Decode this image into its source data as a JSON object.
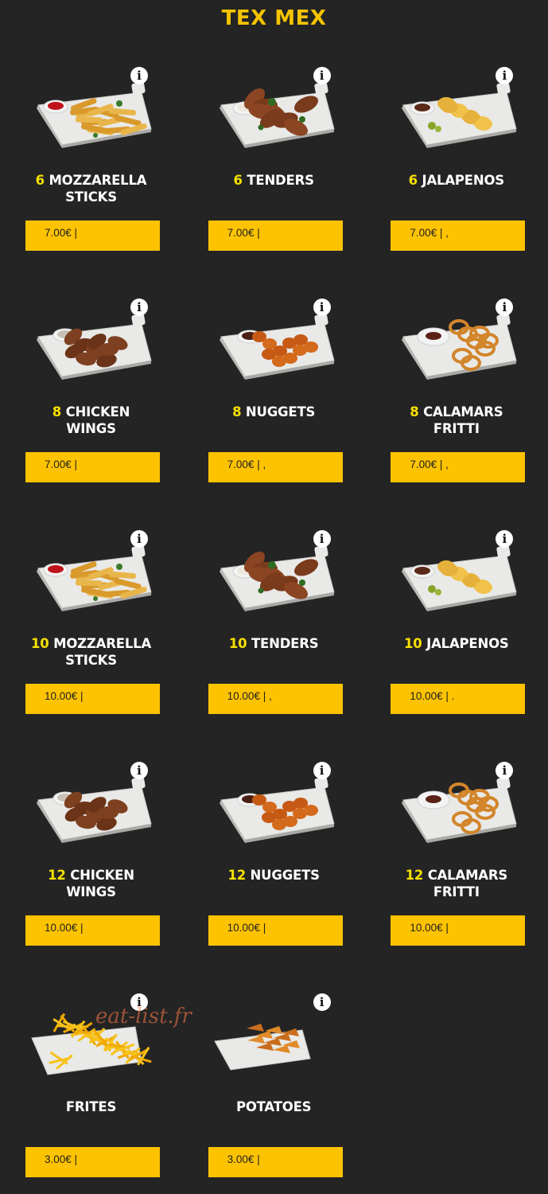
{
  "section_title": "TEX MEX",
  "watermark": "eat-list.fr",
  "items": [
    {
      "qty": "6",
      "name": "MOZZARELLA STICKS",
      "line1": "MOZZARELLA",
      "line2": "STICKS",
      "price": "7.00€ |",
      "icon": "mozzarella-sticks"
    },
    {
      "qty": "6",
      "name": "TENDERS",
      "line1": "TENDERS",
      "line2": "",
      "price": "7.00€ |",
      "icon": "tenders"
    },
    {
      "qty": "6",
      "name": "JALAPENOS",
      "line1": "JALAPENOS",
      "line2": "",
      "price": "7.00€ | ,",
      "icon": "jalapenos"
    },
    {
      "qty": "8",
      "name": "CHICKEN WINGS",
      "line1": "CHICKEN",
      "line2": "WINGS",
      "price": "7.00€ |",
      "icon": "chicken-wings"
    },
    {
      "qty": "8",
      "name": "NUGGETS",
      "line1": "NUGGETS",
      "line2": "",
      "price": "7.00€ | ,",
      "icon": "nuggets"
    },
    {
      "qty": "8",
      "name": "CALAMARS FRITTI",
      "line1": "CALAMARS",
      "line2": "FRITTI",
      "price": "7.00€ | ,",
      "icon": "calamars"
    },
    {
      "qty": "10",
      "name": "MOZZARELLA STICKS",
      "line1": "MOZZARELLA",
      "line2": "STICKS",
      "price": "10.00€ |",
      "icon": "mozzarella-sticks"
    },
    {
      "qty": "10",
      "name": "TENDERS",
      "line1": "TENDERS",
      "line2": "",
      "price": "10.00€ | ,",
      "icon": "tenders"
    },
    {
      "qty": "10",
      "name": "JALAPENOS",
      "line1": "JALAPENOS",
      "line2": "",
      "price": "10.00€ | .",
      "icon": "jalapenos"
    },
    {
      "qty": "12",
      "name": "CHICKEN WINGS",
      "line1": "CHICKEN",
      "line2": "WINGS",
      "price": "10.00€ |",
      "icon": "chicken-wings"
    },
    {
      "qty": "12",
      "name": "NUGGETS",
      "line1": "NUGGETS",
      "line2": "",
      "price": "10.00€ |",
      "icon": "nuggets"
    },
    {
      "qty": "12",
      "name": "CALAMARS FRITTI",
      "line1": "CALAMARS",
      "line2": "FRITTI",
      "price": "10.00€ |",
      "icon": "calamars"
    },
    {
      "qty": "",
      "name": "FRITES",
      "line1": "FRITES",
      "line2": "",
      "price": "3.00€ |",
      "icon": "frites"
    },
    {
      "qty": "",
      "name": "POTATOES",
      "line1": "POTATOES",
      "line2": "",
      "price": "3.00€ |",
      "icon": "potatoes"
    }
  ],
  "colors": {
    "background": "#242424",
    "accent": "#fdc300",
    "title": "#f5c400",
    "qty": "#f5e000"
  },
  "info_icon": "i"
}
